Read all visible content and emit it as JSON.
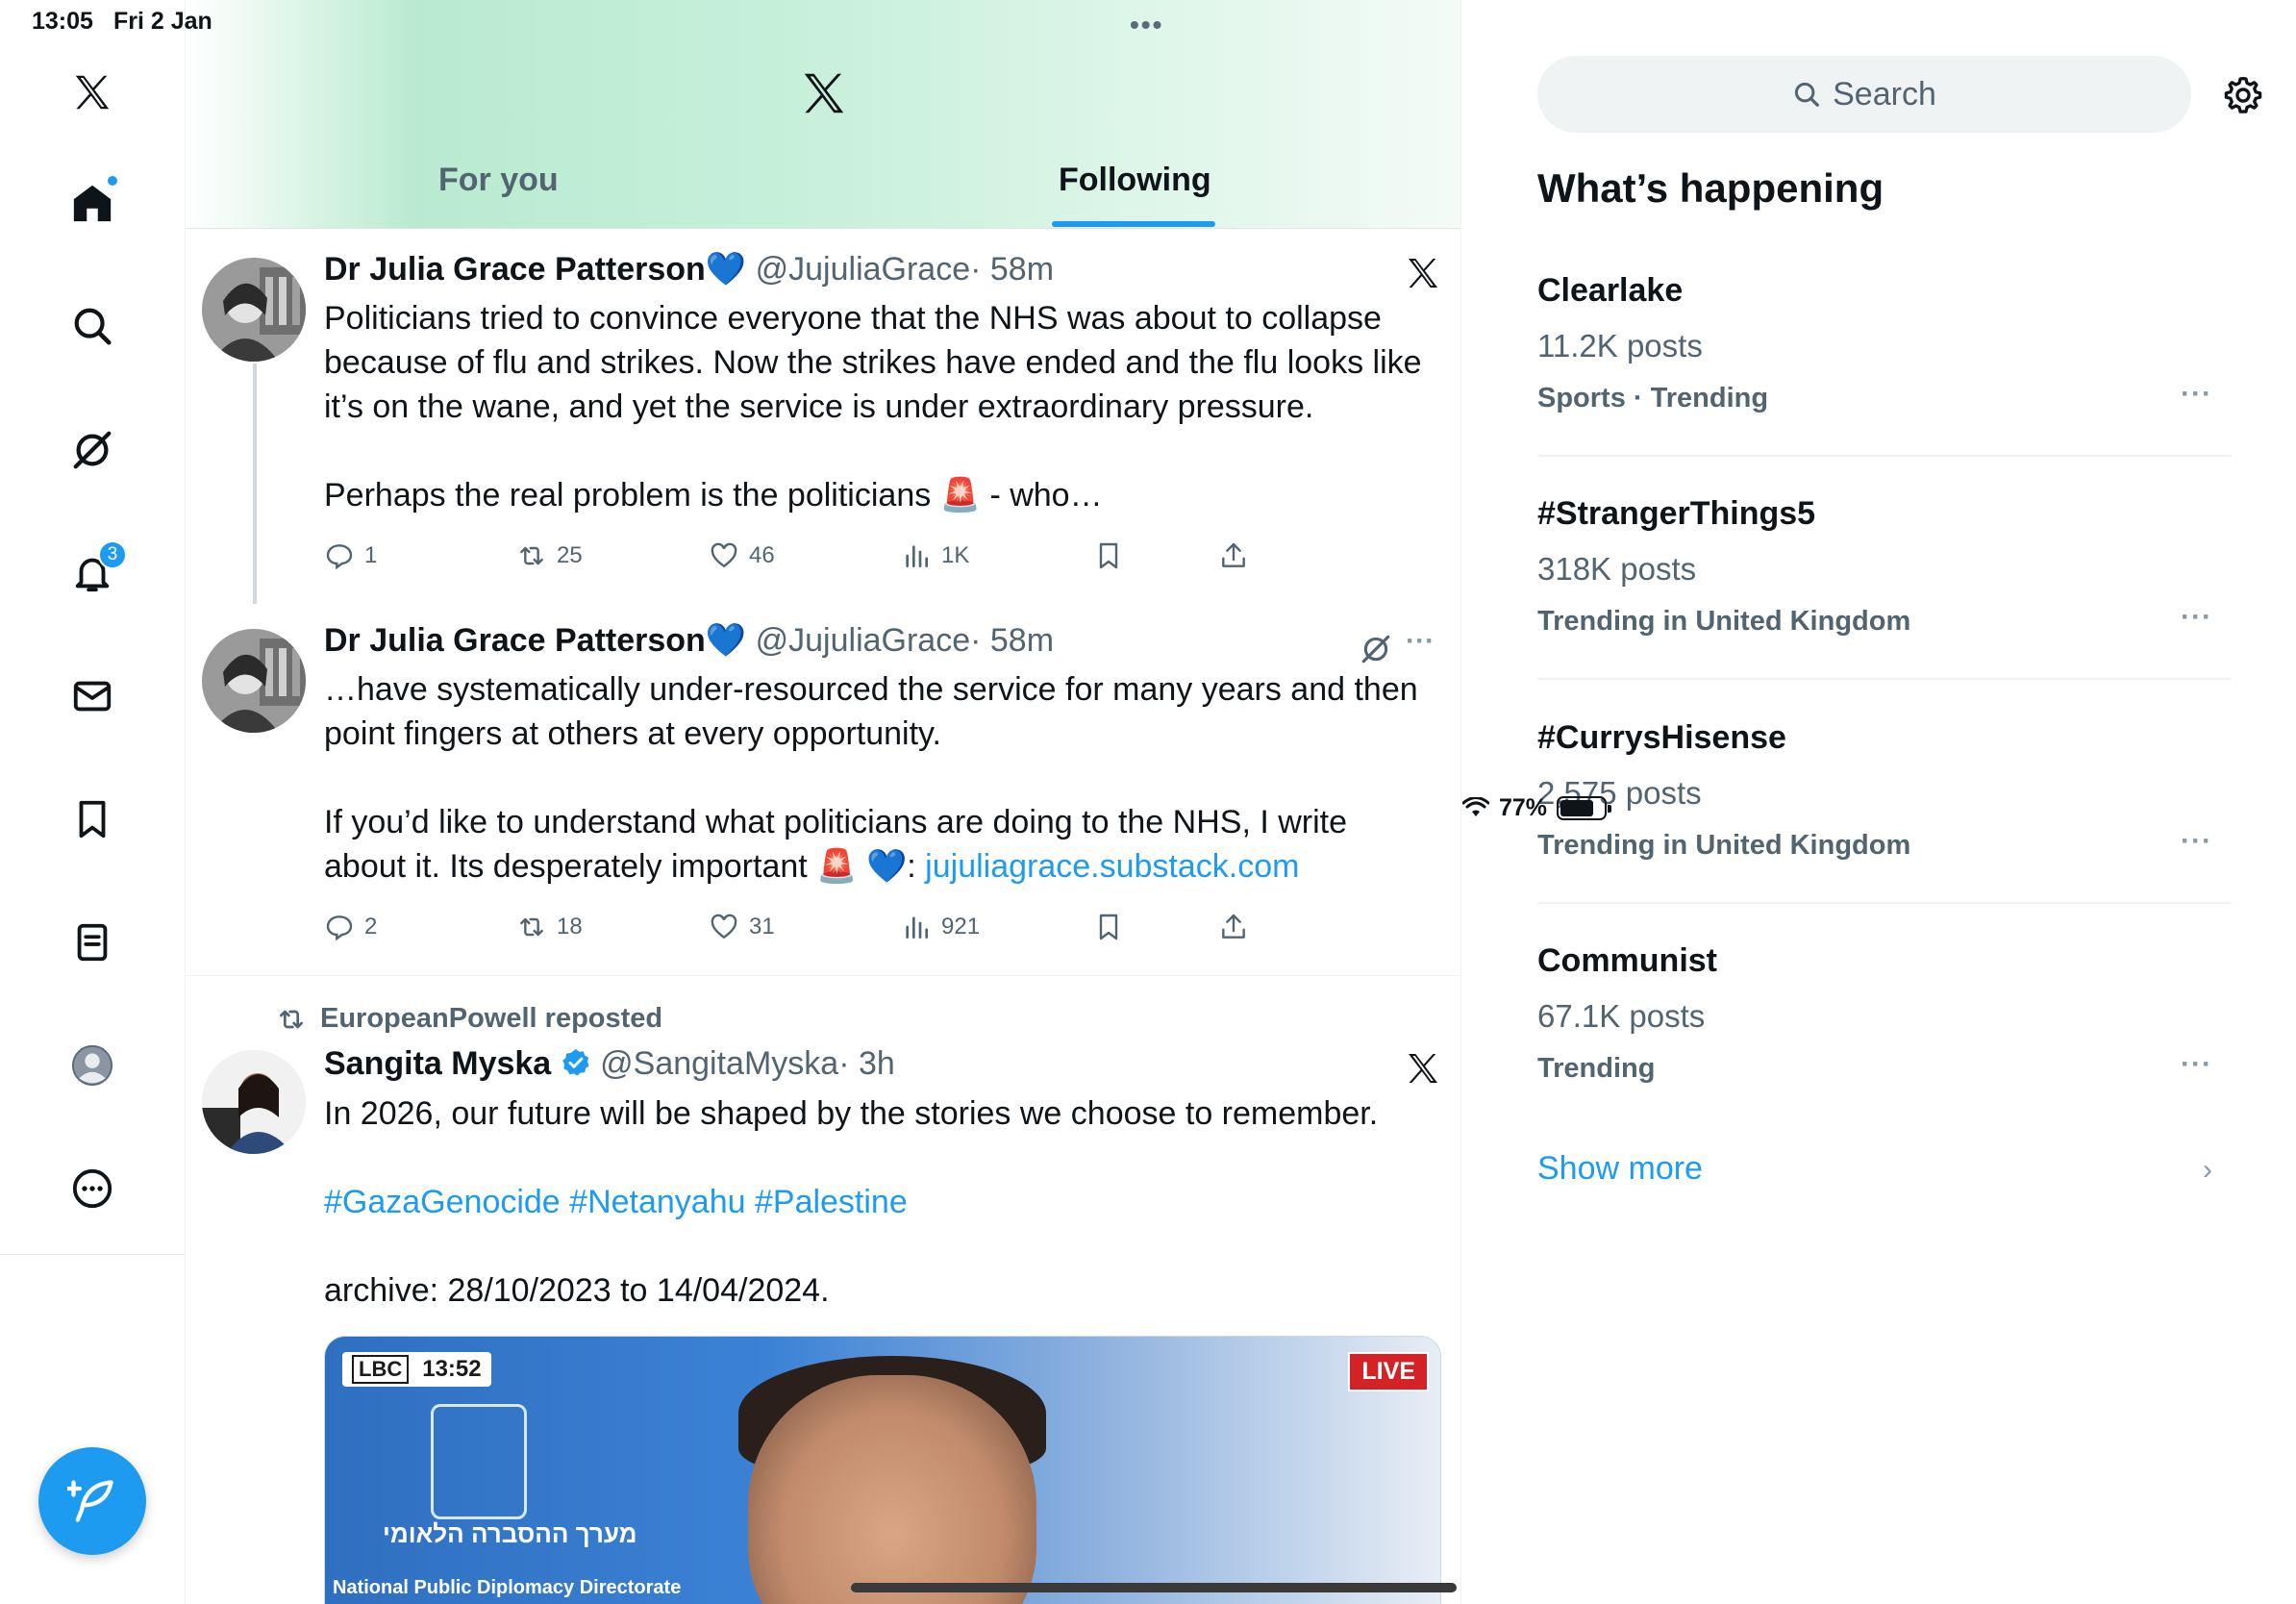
{
  "status_bar": {
    "time": "13:05",
    "date": "Fri 2 Jan",
    "battery": "77%",
    "battery_level": 0.77,
    "multitask_dots": "•••"
  },
  "nav": {
    "items": [
      {
        "name": "home",
        "icon": "home-icon",
        "has_dot": true
      },
      {
        "name": "explore",
        "icon": "search-icon"
      },
      {
        "name": "grok",
        "icon": "grok-icon"
      },
      {
        "name": "notifications",
        "icon": "bell-icon",
        "badge": "3"
      },
      {
        "name": "messages",
        "icon": "mail-icon"
      },
      {
        "name": "bookmarks",
        "icon": "bookmark-icon"
      },
      {
        "name": "lists",
        "icon": "list-icon"
      },
      {
        "name": "profile",
        "icon": "avatar-icon"
      },
      {
        "name": "more",
        "icon": "more-circle-icon"
      }
    ],
    "compose_icon": "compose-feather-icon"
  },
  "header": {
    "tabs": [
      {
        "label": "For you",
        "active": false
      },
      {
        "label": "Following",
        "active": true
      }
    ]
  },
  "posts": [
    {
      "author": "Dr Julia Grace Patterson",
      "emoji": "💙",
      "handle": "@JujuliaGrace",
      "time": "· 58m",
      "text_lines": [
        "Politicians tried to convince everyone that the NHS was about to collapse",
        "because of flu and strikes. Now the strikes have ended and the flu looks like",
        "it’s on the wane, and yet the service is under extraordinary pressure."
      ],
      "text_more": "Perhaps the real problem is the politicians 🚨 - who…",
      "replies": "1",
      "reposts": "25",
      "likes": "46",
      "views": "1K"
    },
    {
      "author": "Dr Julia Grace Patterson",
      "emoji": "💙",
      "handle": "@JujuliaGrace",
      "time": "· 58m",
      "text_lines": [
        "…have systematically under-resourced the service for many years and then",
        "point fingers at others at every opportunity."
      ],
      "text_p2_line1": "If you’d like to understand what politicians are doing to the NHS, I write",
      "text_p2_line2_prefix": "about it. Its desperately important 🚨 💙: ",
      "link": "jujuliagrace.substack.com",
      "replies": "2",
      "reposts": "18",
      "likes": "31",
      "views": "921"
    },
    {
      "reposted_by": "EuropeanPowell reposted",
      "author": "Sangita Myska",
      "handle": "@SangitaMyska",
      "time": "· 3h",
      "text_line1": "In 2026, our future will be shaped by the stories we choose to remember.",
      "hashtags": "#GazaGenocide #Netanyahu #Palestine",
      "text_line3": "archive: 28/10/2023 to 14/04/2024.",
      "media": {
        "lbc_logo": "LBC",
        "lbc_time": "13:52",
        "live": "LIVE",
        "caption_he": "מערך ההסברה הלאומי",
        "caption_en": "National Public Diplomacy Directorate"
      }
    }
  ],
  "sidebar": {
    "search_placeholder": "Search",
    "title": "What’s happening",
    "trends": [
      {
        "name": "Clearlake",
        "count": "11.2K posts",
        "meta": "Sports · Trending"
      },
      {
        "name": "#StrangerThings5",
        "count": "318K posts",
        "meta": "Trending in United Kingdom"
      },
      {
        "name": "#CurrysHisense",
        "count": "2,575 posts",
        "meta": "Trending in United Kingdom"
      },
      {
        "name": "Communist",
        "count": "67.1K posts",
        "meta": "Trending"
      }
    ],
    "more_glyph": "···",
    "show_more": "Show more",
    "accent": "#1d9bf0"
  }
}
